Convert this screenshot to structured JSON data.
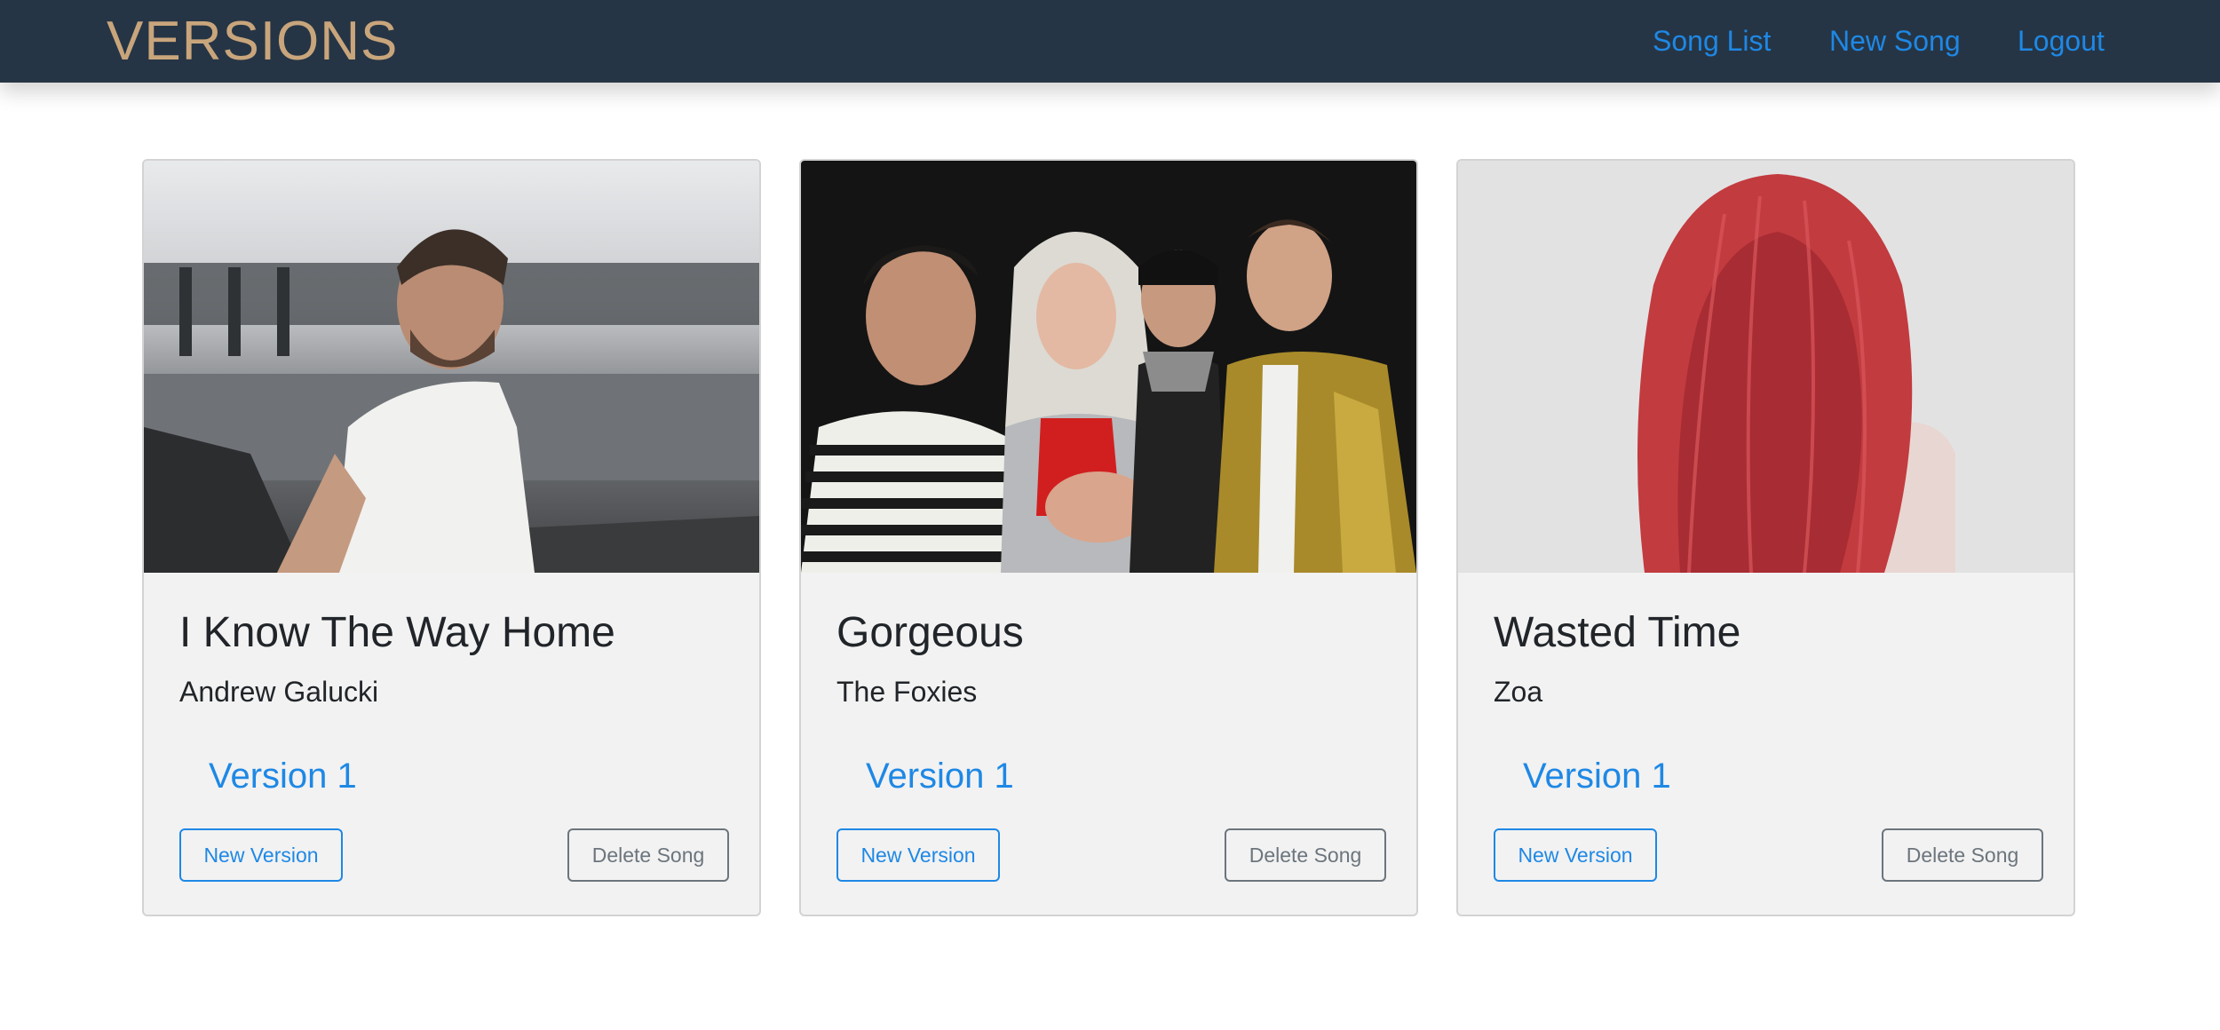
{
  "navbar": {
    "brand": "VERSIONS",
    "links": [
      {
        "label": "Song List"
      },
      {
        "label": "New Song"
      },
      {
        "label": "Logout"
      }
    ]
  },
  "colors": {
    "navbar_bg": "#263545",
    "brand": "#c9a57c",
    "link": "#1e88e5",
    "card_bg": "#f2f2f2",
    "delete_button": "#6c757d"
  },
  "songs": [
    {
      "title": "I Know The Way Home",
      "artist": "Andrew Galucki",
      "versions": [
        {
          "label": "Version 1"
        }
      ],
      "new_version_label": "New Version",
      "delete_label": "Delete Song",
      "image": "artist-photo"
    },
    {
      "title": "Gorgeous",
      "artist": "The Foxies",
      "versions": [
        {
          "label": "Version 1"
        }
      ],
      "new_version_label": "New Version",
      "delete_label": "Delete Song",
      "image": "band-photo"
    },
    {
      "title": "Wasted Time",
      "artist": "Zoa",
      "versions": [
        {
          "label": "Version 1"
        }
      ],
      "new_version_label": "New Version",
      "delete_label": "Delete Song",
      "image": "artist-photo"
    }
  ]
}
